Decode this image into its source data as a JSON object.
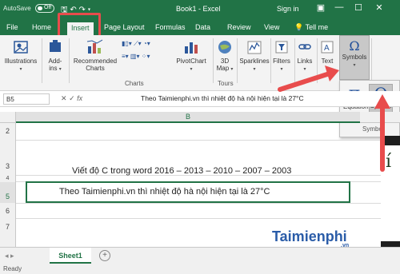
{
  "titlebar": {
    "autosave": "AutoSave",
    "autosave_state": "Off",
    "title": "Book1 - Excel",
    "signin": "Sign in",
    "minimize": "—",
    "restore": "☐",
    "close": "✕"
  },
  "tabs": [
    "File",
    "Home",
    "Insert",
    "Page Layout",
    "Formulas",
    "Data",
    "Review",
    "View"
  ],
  "tell_me_icon": "lightbulb-icon",
  "tell_me": "Tell me",
  "ribbon": {
    "illustrations": "Illustrations",
    "addins_line1": "Add-",
    "addins_line2": "ins",
    "recommended_line1": "Recommended",
    "recommended_line2": "Charts",
    "pivotchart": "PivotChart",
    "map_line1": "3D",
    "map_line2": "Map",
    "sparklines": "Sparklines",
    "filters": "Filters",
    "links": "Links",
    "text": "Text",
    "symbols": "Symbols",
    "group_charts": "Charts",
    "group_tours": "Tours"
  },
  "symbols_panel": {
    "equation": "Equation",
    "symbol": "Symbol",
    "group": "Symbo"
  },
  "formulabar": {
    "namebox": "B5",
    "formula": "Theo Taimienphi.vn thì nhiệt độ hà nội hiện tại là 27°C"
  },
  "grid": {
    "column": "B",
    "rows": [
      "2",
      "3",
      "4",
      "5",
      "6",
      "7"
    ],
    "cell_b3": "Viết độ C trong word 2016 – 2013 – 2010 – 2007 – 2003",
    "cell_b5": "Theo Taimienphi.vn thì nhiệt độ hà nội hiện tại là 27°C"
  },
  "sheet": {
    "name": "Sheet1",
    "add": "+",
    "nav": "◂ ▸"
  },
  "status": "Ready",
  "logo": {
    "text": "aimienphi",
    "suffix": ".vn"
  },
  "colors": {
    "excel_green": "#217346",
    "highlight_red": "#e84c4c",
    "ribbon_bg": "#f3f3f3"
  }
}
